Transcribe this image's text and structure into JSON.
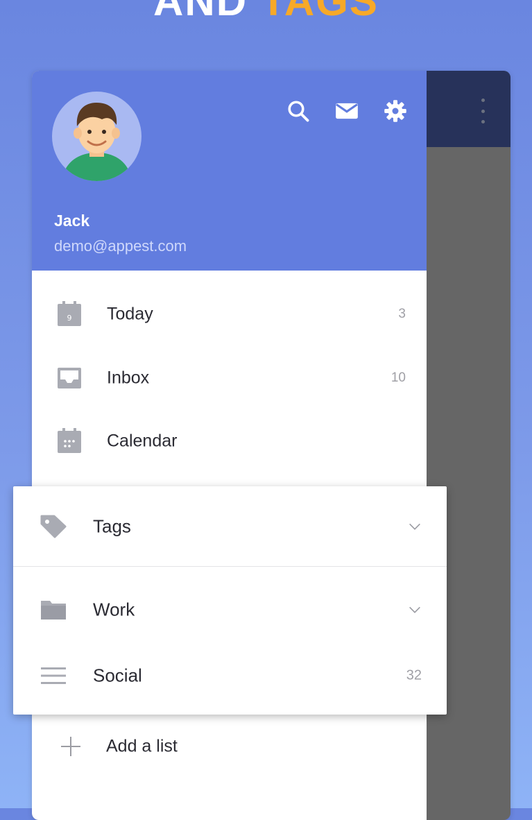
{
  "banner": {
    "word1": "AND",
    "word2": "TAGS"
  },
  "colors": {
    "drawer_header": "#627ddf",
    "app_bar": "#27325a",
    "accent": "#f7a928",
    "scrim": "#666666"
  },
  "user": {
    "name": "Jack",
    "email": "demo@appest.com"
  },
  "header_icons": [
    "search-icon",
    "mail-icon",
    "gear-icon"
  ],
  "nav": {
    "items": [
      {
        "label": "Today",
        "count": "3",
        "icon": "calendar-day-icon",
        "icon_text": "9"
      },
      {
        "label": "Inbox",
        "count": "10",
        "icon": "inbox-icon"
      },
      {
        "label": "Calendar",
        "count": "",
        "icon": "calendar-icon"
      }
    ]
  },
  "popup": {
    "tags": {
      "label": "Tags",
      "icon": "tag-icon"
    },
    "work": {
      "label": "Work",
      "icon": "folder-icon"
    },
    "social": {
      "label": "Social",
      "count": "32",
      "icon": "list-icon"
    }
  },
  "add_list": {
    "label": "Add a list",
    "icon": "plus-icon"
  }
}
